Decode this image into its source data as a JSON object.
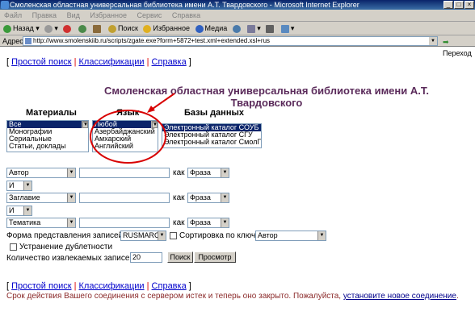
{
  "window": {
    "title": "Смоленская областная универсальная библиотека имени А.Т. Твардовского - Microsoft Internet Explorer"
  },
  "menu": [
    "Файл",
    "Правка",
    "Вид",
    "Избранное",
    "Сервис",
    "Справка"
  ],
  "toolbar": {
    "back": "Назад",
    "search": "Поиск",
    "favorites": "Избранное",
    "media": "Медиа"
  },
  "address": {
    "label": "Адрес:",
    "url": "http://www.smolenskiib.ru/scripts/zgate.exe?form+5872+test.xml+extended.xsl+rus",
    "go": "Переход"
  },
  "nav": {
    "simple": "Простой поиск",
    "classif": "Классификации",
    "help": "Справка",
    "open": "[",
    "close": "]",
    "sep": "|"
  },
  "heading": "Смоленская областная универсальная библиотека имени А.Т. Твардовского",
  "materials": {
    "label": "Материалы",
    "items": [
      "Все",
      "Монографии",
      "Сериальные",
      "Статьи, доклады"
    ]
  },
  "language": {
    "label": "Язык",
    "items": [
      "Любой",
      "Азербайджанский",
      "Амхарский",
      "Английский"
    ]
  },
  "databases": {
    "label": "Базы данных",
    "items": [
      "Электронный каталог СОУБ",
      "Электронный каталог СГУ",
      "Электронный каталог СмолГУ"
    ]
  },
  "rows": [
    {
      "field": "Автор",
      "kak": "как",
      "mode": "Фраза"
    },
    {
      "op": "И"
    },
    {
      "field": "Заглавие",
      "kak": "как",
      "mode": "Фраза"
    },
    {
      "op": "И"
    },
    {
      "field": "Тематика",
      "kak": "как",
      "mode": "Фраза"
    }
  ],
  "format": {
    "label": "Форма представления записей",
    "value": "RUSMARC",
    "sort_label": "Сортировка по ключу",
    "sort_value": "Автор"
  },
  "dedupe": "Устранение дублетности",
  "count": {
    "label": "Количество извлекаемых записей",
    "value": "20",
    "search": "Поиск",
    "view": "Просмотр"
  },
  "message": {
    "text": "Срок действия Вашего соединения с сервером истек и теперь оно закрыто. Пожалуйста, ",
    "link": "установите новое соединение",
    "end": "."
  }
}
